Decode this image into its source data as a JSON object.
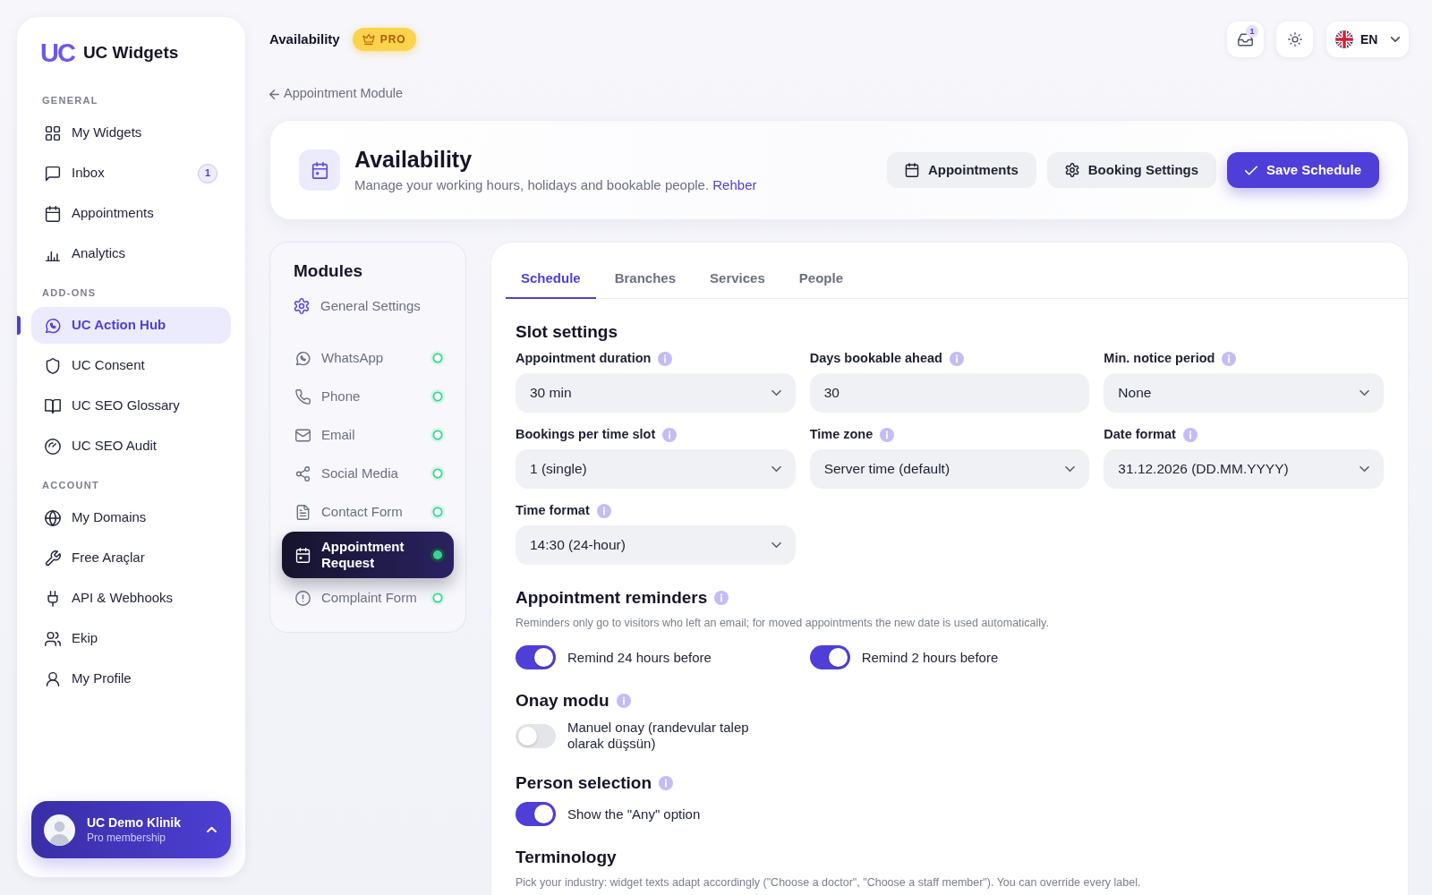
{
  "sidebar": {
    "logo_mark": "UC",
    "brand": "UC Widgets",
    "sections": [
      {
        "title": "GENERAL",
        "items": [
          {
            "label": "My Widgets",
            "selected": false
          },
          {
            "label": "Inbox",
            "selected": false,
            "badge": "1"
          },
          {
            "label": "Appointments",
            "selected": false
          },
          {
            "label": "Analytics",
            "selected": false
          }
        ]
      },
      {
        "title": "ADD-ONS",
        "items": [
          {
            "label": "UC Action Hub",
            "selected": true
          },
          {
            "label": "UC Consent",
            "selected": false
          },
          {
            "label": "UC SEO Glossary",
            "selected": false
          },
          {
            "label": "UC SEO Audit",
            "selected": false
          }
        ]
      },
      {
        "title": "ACCOUNT",
        "items": [
          {
            "label": "My Domains",
            "selected": false
          },
          {
            "label": "Free Araçlar",
            "selected": false
          },
          {
            "label": "API & Webhooks",
            "selected": false
          },
          {
            "label": "Ekip",
            "selected": false
          },
          {
            "label": "My Profile",
            "selected": false
          }
        ]
      }
    ],
    "profile": {
      "name": "UC Demo Klinik",
      "plan": "Pro membership"
    }
  },
  "topbar": {
    "title": "Availability",
    "badge": "PRO",
    "notifications": "1",
    "language": "EN"
  },
  "breadcrumb": {
    "label": "Appointment Module"
  },
  "header": {
    "title": "Availability",
    "description": "Manage your working hours, holidays and bookable people.",
    "link": "Rehber",
    "buttons": [
      {
        "label": "Appointments",
        "kind": "secondary"
      },
      {
        "label": "Booking Settings",
        "kind": "secondary"
      },
      {
        "label": "Save Schedule",
        "kind": "primary"
      }
    ]
  },
  "modules": {
    "title": "Modules",
    "settings_link": "General Settings",
    "items": [
      {
        "label": "WhatsApp",
        "selected": false
      },
      {
        "label": "Phone",
        "selected": false
      },
      {
        "label": "Email",
        "selected": false
      },
      {
        "label": "Social Media",
        "selected": false
      },
      {
        "label": "Contact Form",
        "selected": false
      },
      {
        "label": "Appointment Request",
        "selected": true
      },
      {
        "label": "Complaint Form",
        "selected": false
      }
    ]
  },
  "tabs": [
    {
      "label": "Schedule",
      "selected": true
    },
    {
      "label": "Branches",
      "selected": false
    },
    {
      "label": "Services",
      "selected": false
    },
    {
      "label": "People",
      "selected": false
    }
  ],
  "schedule": {
    "sections": [
      {
        "title": "Slot settings",
        "info": false,
        "fields": [
          {
            "label": "Appointment duration",
            "kind": "select",
            "value": "30 min"
          },
          {
            "label": "Days bookable ahead",
            "kind": "input",
            "value": "30"
          },
          {
            "label": "Min. notice period",
            "kind": "select",
            "value": "None"
          },
          {
            "label": "Bookings per time slot",
            "kind": "select",
            "value": "1 (single)"
          },
          {
            "label": "Time zone",
            "kind": "select",
            "value": "Server time (default)"
          },
          {
            "label": "Date format",
            "kind": "select",
            "value": "31.12.2026 (DD.MM.YYYY)"
          },
          {
            "label": "Time format",
            "kind": "select",
            "value": "14:30 (24-hour)"
          }
        ]
      },
      {
        "title": "Appointment reminders",
        "info": true,
        "description": "Reminders only go to visitors who left an email; for moved appointments the new date is used automatically.",
        "toggles": [
          {
            "label": "Remind 24 hours before",
            "on": true
          },
          {
            "label": "Remind 2 hours before",
            "on": true
          }
        ]
      },
      {
        "title": "Onay modu",
        "info": true,
        "toggles": [
          {
            "label": "Manuel onay (randevular talep olarak düşsün)",
            "on": false
          }
        ]
      },
      {
        "title": "Person selection",
        "info": true,
        "toggles": [
          {
            "label": "Show the \"Any\" option",
            "on": true
          }
        ]
      },
      {
        "title": "Terminology",
        "info": false,
        "description": "Pick your industry: widget texts adapt accordingly (\"Choose a doctor\", \"Choose a staff member\"). You can override every label."
      }
    ]
  }
}
